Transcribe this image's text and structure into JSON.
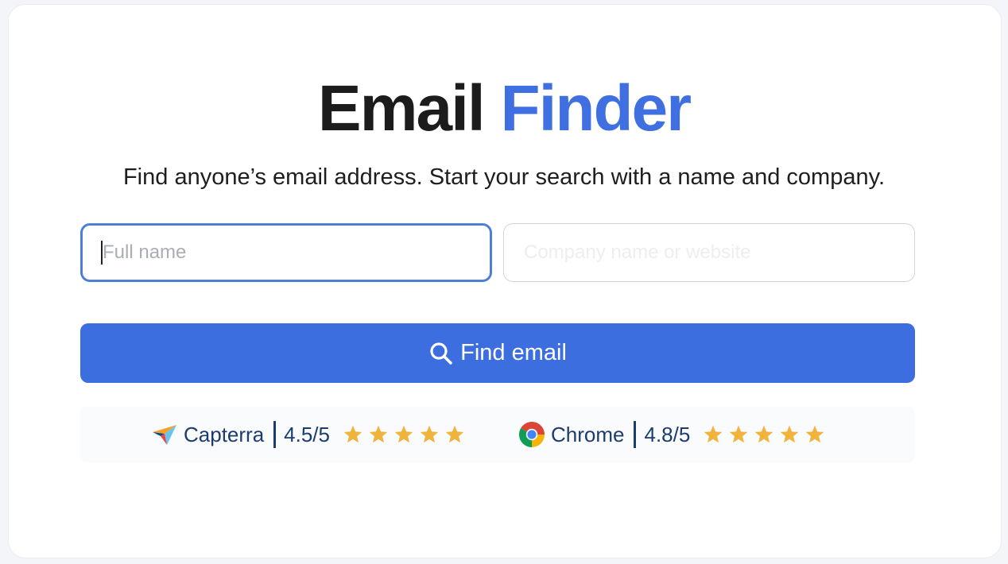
{
  "title": {
    "word1": "Email",
    "word2": "Finder"
  },
  "subtitle": "Find anyone’s email address. Start your search with a name and company.",
  "form": {
    "full_name_placeholder": "Full name",
    "company_placeholder": "Company name or website",
    "find_button_label": "Find email",
    "find_button_icon": "search-icon"
  },
  "ratings": [
    {
      "name": "Capterra",
      "score": "4.5/5",
      "stars": 5,
      "icon": "capterra-logo-icon"
    },
    {
      "name": "Chrome",
      "score": "4.8/5",
      "stars": 5,
      "icon": "chrome-logo-icon"
    }
  ],
  "colors": {
    "accent": "#3d6ee0",
    "title_highlight": "#3f6fe0",
    "star": "#f0b43c",
    "rating_text": "#1c3c6e",
    "focus_border": "#4f7fd2"
  }
}
